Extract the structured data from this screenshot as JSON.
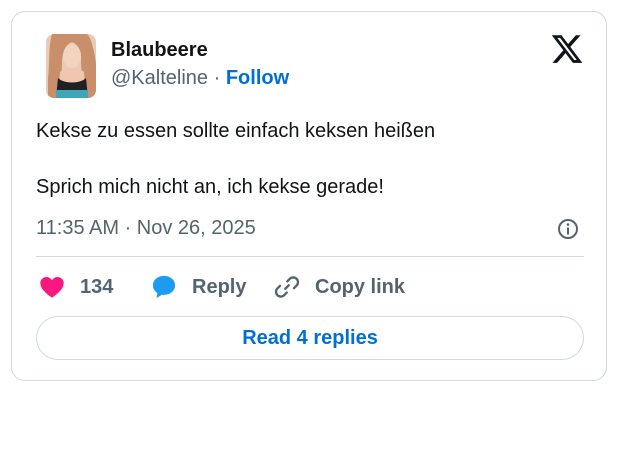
{
  "tweet": {
    "author": {
      "display_name": "Blaubeere",
      "handle": "@Kalteline",
      "separator": "·",
      "follow_label": "Follow"
    },
    "text_lines": [
      "Kekse zu essen sollte einfach keksen heißen",
      "Sprich mich nicht an, ich kekse gerade!"
    ],
    "timestamp": "11:35 AM · Nov 26, 2025",
    "actions": {
      "like_count": "134",
      "reply_label": "Reply",
      "copy_link_label": "Copy link"
    },
    "read_replies_label": "Read 4 replies"
  },
  "icons": {
    "brand": "x-logo-icon",
    "info": "info-icon",
    "like": "heart-icon",
    "reply": "speech-bubble-icon",
    "copy": "link-icon"
  },
  "colors": {
    "link_blue": "#006fd6",
    "like_pink": "#f91880",
    "reply_blue": "#1d9bf0",
    "secondary_text": "#536471",
    "border": "#cfd9de"
  }
}
